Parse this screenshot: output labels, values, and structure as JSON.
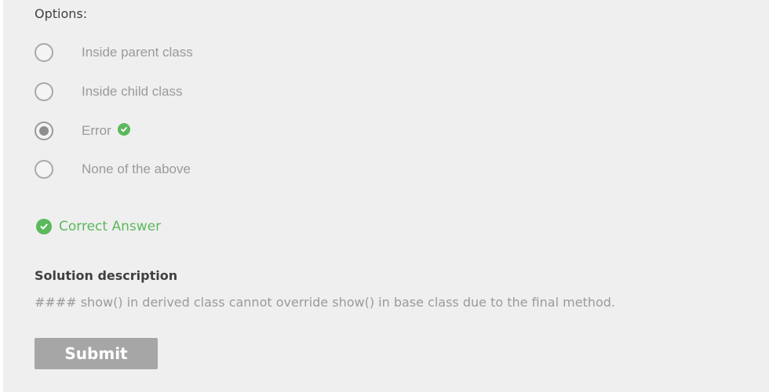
{
  "options_label": "Options:",
  "options": [
    {
      "label": "Inside parent class",
      "selected": false,
      "correct": false
    },
    {
      "label": "Inside child class",
      "selected": false,
      "correct": false
    },
    {
      "label": "Error",
      "selected": true,
      "correct": true
    },
    {
      "label": "None of the above",
      "selected": false,
      "correct": false
    }
  ],
  "result": {
    "text": "Correct Answer",
    "icon": "check-circle-icon",
    "color": "#5cb85c"
  },
  "solution": {
    "title": "Solution description",
    "text": "#### show() in derived class cannot override show() in base class due to the final method."
  },
  "submit_label": "Submit",
  "colors": {
    "accent": "#5cb85c",
    "button": "#a6a6a6",
    "panel": "#efefef"
  }
}
